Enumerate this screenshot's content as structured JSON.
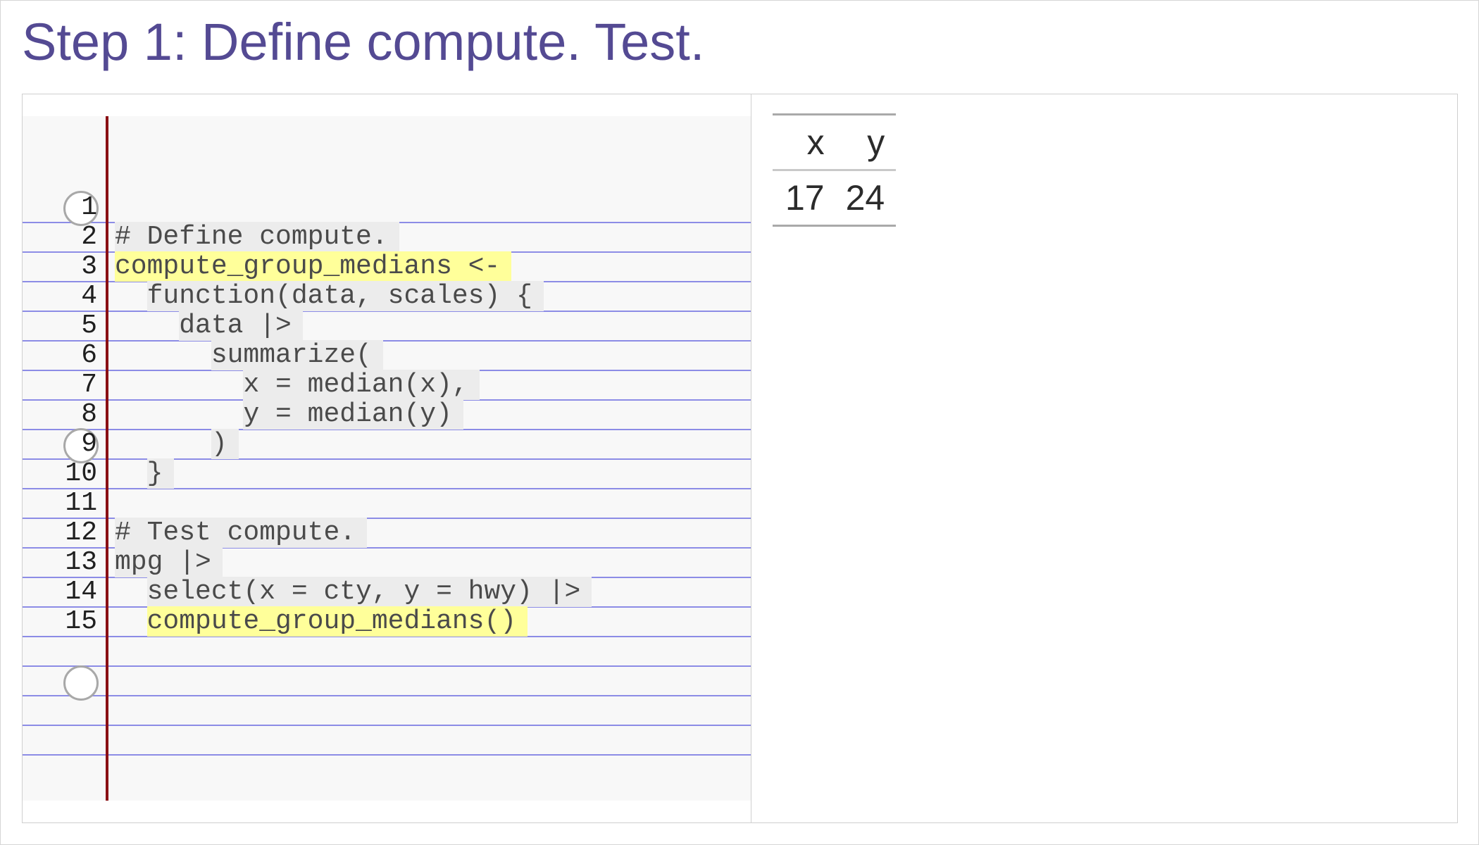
{
  "slide": {
    "title": "Step 1: Define compute. Test."
  },
  "code": {
    "lines": [
      {
        "number": "1",
        "segments": []
      },
      {
        "number": "2",
        "segments": [
          {
            "text": "# Define compute.",
            "highlight": false
          }
        ]
      },
      {
        "number": "3",
        "segments": [
          {
            "text": "compute_group_medians <-",
            "highlight": true
          }
        ]
      },
      {
        "number": "4",
        "indent": "  ",
        "segments": [
          {
            "text": "function(data, scales) {",
            "highlight": false
          }
        ]
      },
      {
        "number": "5",
        "indent": "    ",
        "segments": [
          {
            "text": "data |>",
            "highlight": false
          }
        ]
      },
      {
        "number": "6",
        "indent": "      ",
        "segments": [
          {
            "text": "summarize(",
            "highlight": false
          }
        ]
      },
      {
        "number": "7",
        "indent": "        ",
        "segments": [
          {
            "text": "x = median(x),",
            "highlight": false
          }
        ]
      },
      {
        "number": "8",
        "indent": "        ",
        "segments": [
          {
            "text": "y = median(y)",
            "highlight": false
          }
        ]
      },
      {
        "number": "9",
        "indent": "      ",
        "segments": [
          {
            "text": ")",
            "highlight": false
          }
        ]
      },
      {
        "number": "10",
        "indent": "  ",
        "segments": [
          {
            "text": "}",
            "highlight": false
          }
        ]
      },
      {
        "number": "11",
        "segments": []
      },
      {
        "number": "12",
        "segments": [
          {
            "text": "# Test compute.",
            "highlight": false
          }
        ]
      },
      {
        "number": "13",
        "segments": [
          {
            "text": "mpg |>",
            "highlight": false
          }
        ]
      },
      {
        "number": "14",
        "indent": "  ",
        "segments": [
          {
            "text": "select(x = cty, y = hwy) |>",
            "highlight": false
          }
        ]
      },
      {
        "number": "15",
        "indent": "  ",
        "segments": [
          {
            "text": "compute_group_medians()",
            "highlight": true
          }
        ]
      }
    ]
  },
  "output": {
    "table": {
      "columns": [
        "x",
        "y"
      ],
      "rows": [
        [
          "17",
          "24"
        ]
      ]
    }
  },
  "colors": {
    "title": "#544a93",
    "highlight": "#ffff9a",
    "code_bg": "#ececec",
    "rule_line": "#8c8ce6",
    "margin_line": "#8a0f14"
  }
}
